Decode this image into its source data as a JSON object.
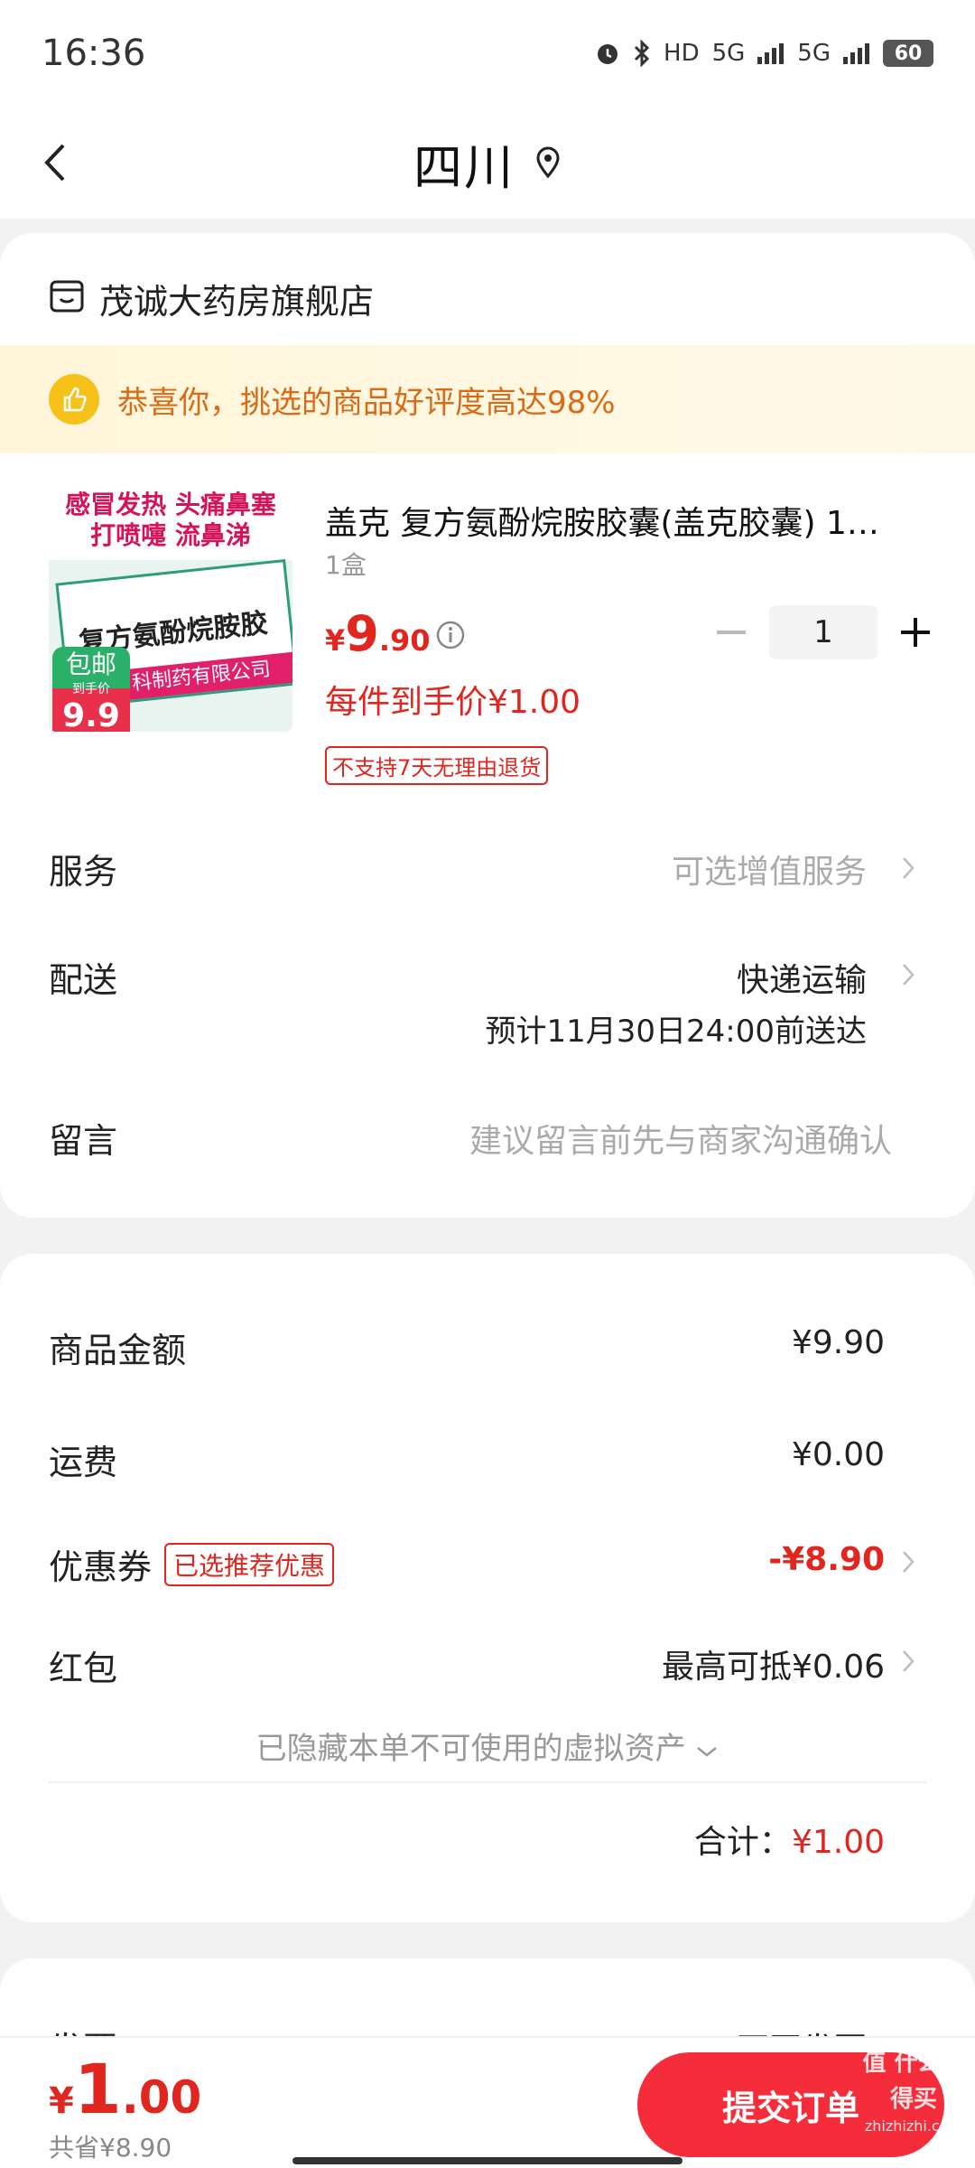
{
  "status_bar": {
    "time": "16:36",
    "net1": "HD",
    "net2": "5G",
    "net3": "5G",
    "battery": "60"
  },
  "header": {
    "title": "四川"
  },
  "shop": {
    "name": "茂诚大药房旗舰店"
  },
  "praise": {
    "text": "恭喜你，挑选的商品好评度高达98%"
  },
  "product": {
    "title": "盖克 复方氨酚烷胺胶囊(盖克胶囊) 1…",
    "spec": "1盒",
    "price_currency": "¥",
    "price_int": "9",
    "price_dec": ".90",
    "quantity": "1",
    "unit_price": "每件到手价¥1.00",
    "no_return_tag": "不支持7天无理由退货",
    "image": {
      "banner_line1": "感冒发热 头痛鼻塞",
      "banner_line2": "打喷嚏 流鼻涕",
      "box_title": "复方氨酚烷胺胶囊",
      "box_stripe": "科制药有限公司",
      "badge_top": "包邮",
      "badge_mid": "到手价",
      "badge_price": "9.9"
    }
  },
  "service": {
    "label": "服务",
    "value": "可选增值服务"
  },
  "delivery": {
    "label": "配送",
    "method": "快递运输",
    "eta": "预计11月30日24:00前送达"
  },
  "message": {
    "label": "留言",
    "placeholder": "建议留言前先与商家沟通确认"
  },
  "summary": {
    "goods_label": "商品金额",
    "goods_value": "¥9.90",
    "shipping_label": "运费",
    "shipping_value": "¥0.00",
    "coupon_label": "优惠券",
    "coupon_tag": "已选推荐优惠",
    "coupon_value": "-¥8.90",
    "redpacket_label": "红包",
    "redpacket_value": "最高可抵¥0.06",
    "hidden_assets": "已隐藏本单不可使用的虚拟资产",
    "total_label": "合计：",
    "total_value": "¥1.00"
  },
  "invoice": {
    "label": "发票",
    "value": "不开发票"
  },
  "bottom": {
    "currency": "¥",
    "price_int": "1",
    "price_dec": ".00",
    "saved": "共省¥8.90",
    "submit_label": "提交订单"
  },
  "watermark": {
    "text": "值 什么值得买",
    "sub": "zhizhizhi.com"
  },
  "colors": {
    "accent_red": "#e0261e",
    "button_red": "#f52d3a",
    "praise_orange": "#d96a16",
    "praise_bg": "#fff5d9"
  }
}
